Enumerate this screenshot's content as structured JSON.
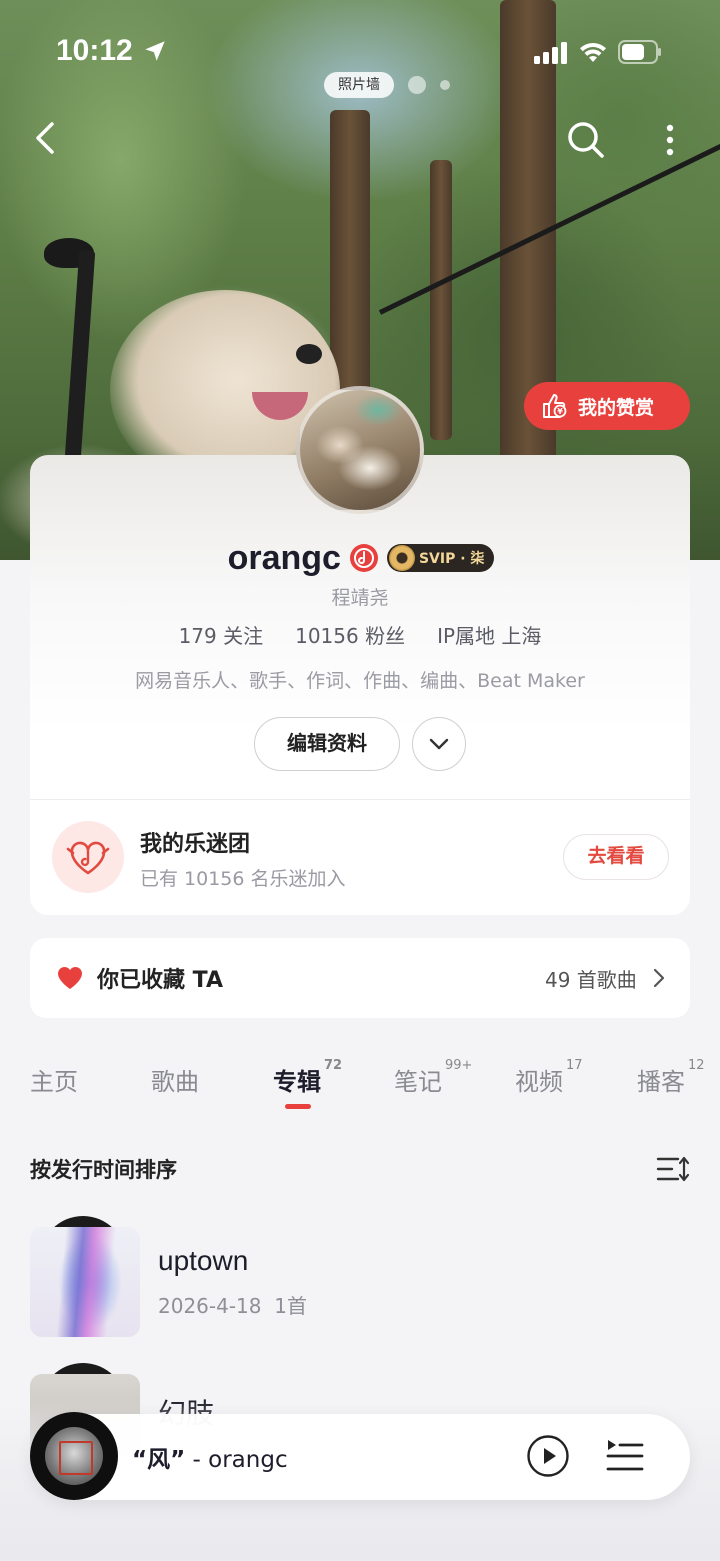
{
  "status": {
    "time": "10:12"
  },
  "header": {
    "photo_wall_label": "照片墙",
    "reward_label": "我的赞赏"
  },
  "profile": {
    "name": "orangc",
    "svip_label": "SVIP · 柒",
    "real_name": "程靖尧",
    "following": "179 关注",
    "fans": "10156 粉丝",
    "ip": "IP属地 上海",
    "tags": "网易音乐人、歌手、作词、作曲、编曲、Beat Maker",
    "edit_label": "编辑资料"
  },
  "fanclub": {
    "title": "我的乐迷团",
    "subtitle": "已有 10156 名乐迷加入",
    "button_label": "去看看"
  },
  "collected": {
    "label": "你已收藏 TA",
    "count": "49 首歌曲"
  },
  "tabs": [
    {
      "label": "主页",
      "count": ""
    },
    {
      "label": "歌曲",
      "count": ""
    },
    {
      "label": "专辑",
      "count": "72"
    },
    {
      "label": "笔记",
      "count": "99+"
    },
    {
      "label": "视频",
      "count": "17"
    },
    {
      "label": "播客",
      "count": "12"
    }
  ],
  "sort": {
    "label": "按发行时间排序"
  },
  "albums": [
    {
      "title": "uptown",
      "date": "2026-4-18",
      "tracks": "1首"
    },
    {
      "title": "幻肢"
    }
  ],
  "player": {
    "song": "“风”",
    "artist": " - orangc"
  },
  "colors": {
    "accent": "#e8413d",
    "svip_gold": "#f3d79a"
  }
}
